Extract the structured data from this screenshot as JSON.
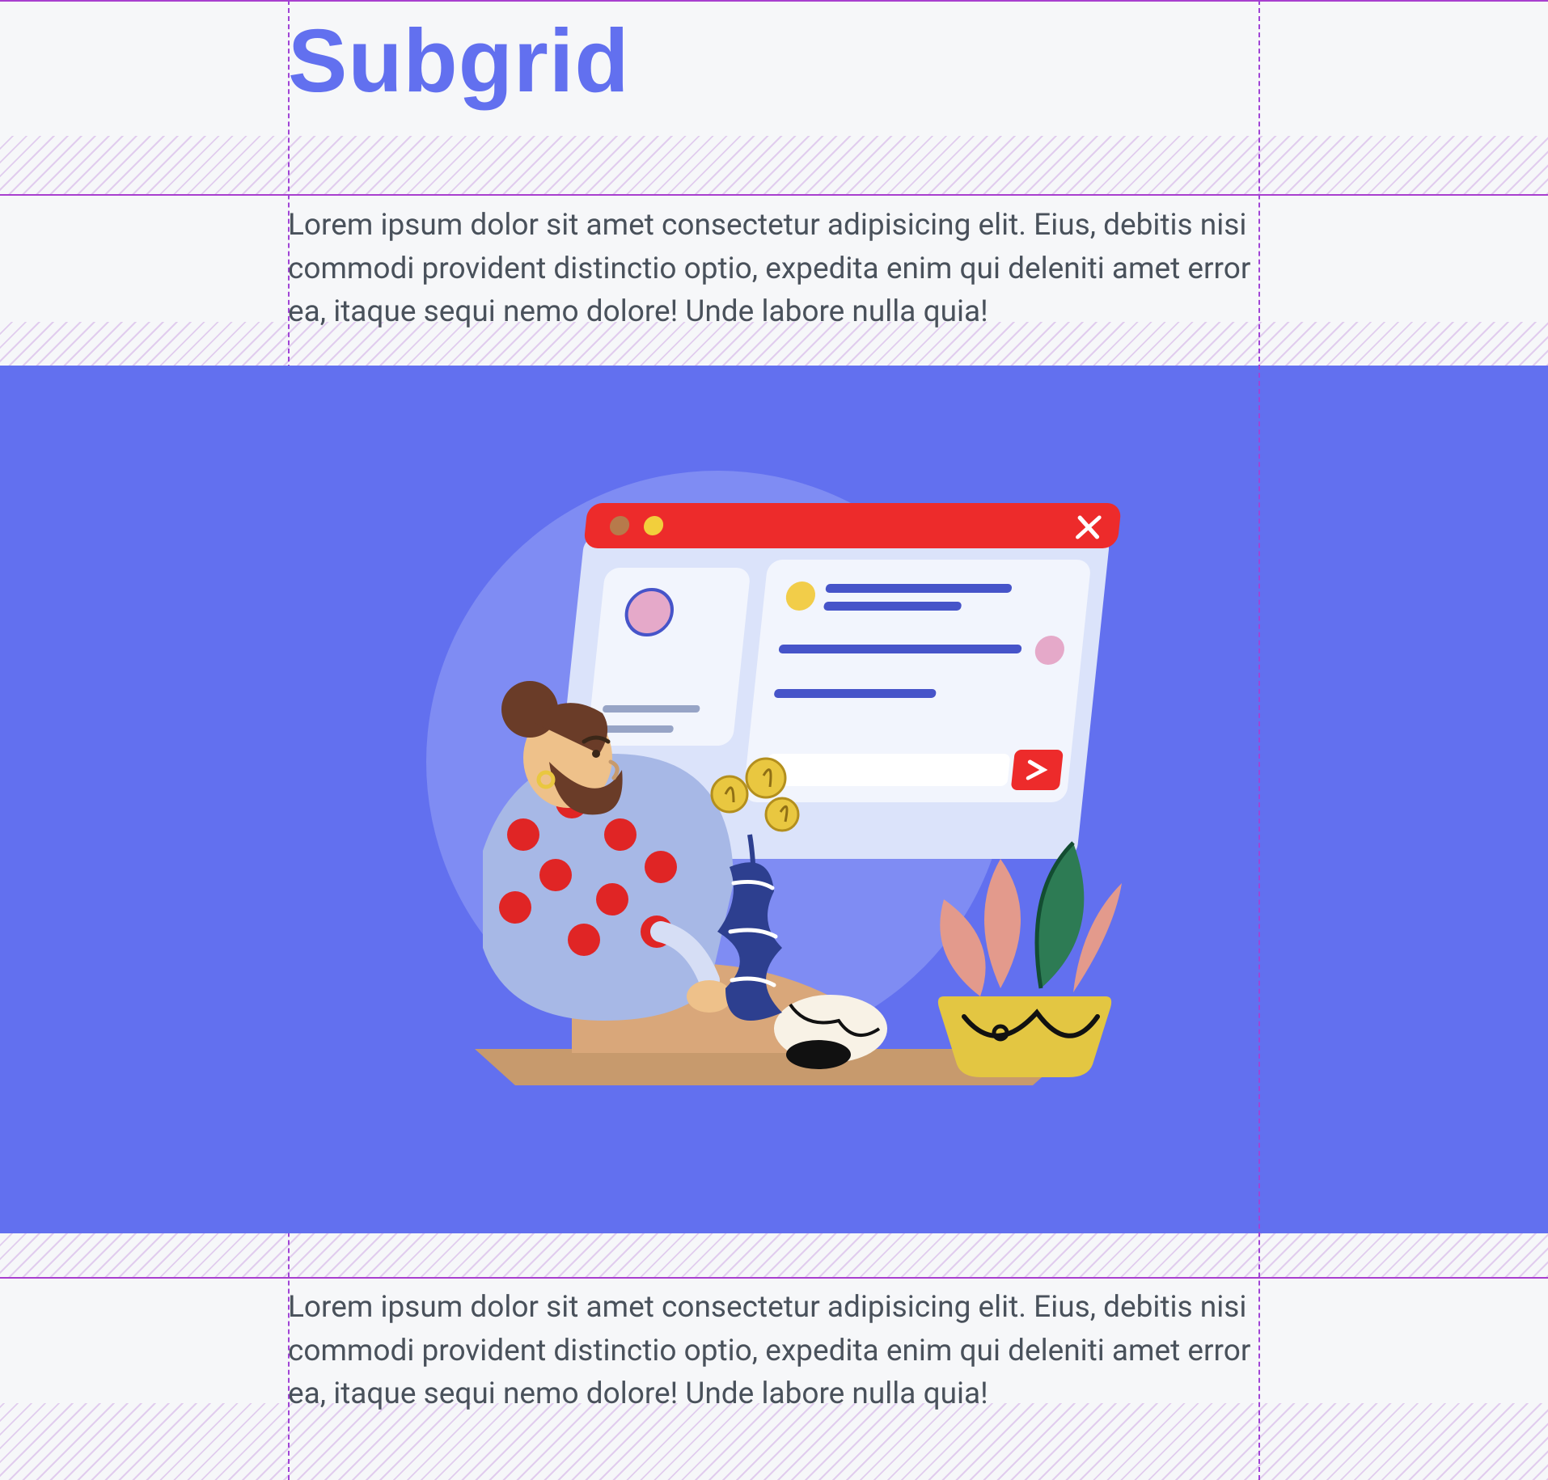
{
  "heading": "Subgrid",
  "paragraph1": "Lorem ipsum dolor sit amet consectetur adipisicing elit. Eius, debitis nisi commodi provident distinctio optio, expedita enim qui deleniti amet error ea, itaque sequi nemo dolore! Unde labore nulla quia!",
  "paragraph2": "Lorem ipsum dolor sit amet consectetur adipisicing elit. Eius, debitis nisi commodi provident distinctio optio, expedita enim qui deleniti amet error ea, itaque sequi nemo dolore! Unde labore nulla quia!",
  "illustration": {
    "name": "person-at-desk-with-chat-app-illustration",
    "browser_window": {
      "title_bar_color": "#ed2b2b",
      "controls": [
        "brown-dot",
        "yellow-dot",
        "close-x"
      ],
      "chat_rows": 4,
      "avatars": 3,
      "send_button": "arrow-right"
    },
    "background_shape": "large-circle",
    "colors": {
      "panel": "#6270ef",
      "circle": "#7f8cf3",
      "window_body": "#dbe3fa",
      "chat_bg": "#f2f5fd",
      "bar": "#4654c9",
      "red": "#ed2b2b",
      "skin": "#eec18a",
      "shirt": "#a7b8e6",
      "shirt_dots": "#e02525",
      "pants": "#d9a77a",
      "shoe": "#f8f2e6",
      "shoe_dark": "#111111",
      "hair": "#6a3c28",
      "vase": "#2d3f8f",
      "flowers": "#e9c740",
      "pot": "#e3c642",
      "leaf_green": "#2d7b54",
      "leaf_pink": "#e39a8c"
    }
  },
  "grid_debug": {
    "column_guides": 3,
    "row_guides_visible": true,
    "hatched_gaps": true,
    "guide_color": "#a83fcf"
  }
}
